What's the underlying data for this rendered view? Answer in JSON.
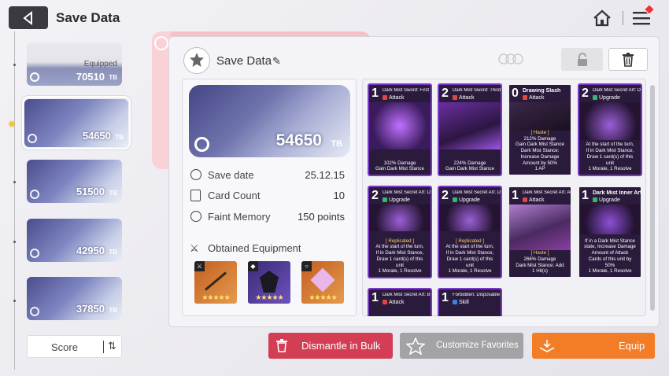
{
  "header": {
    "title": "Save Data"
  },
  "slots": [
    {
      "value": "70510",
      "unit": "TB",
      "label": "Equipped"
    },
    {
      "value": "54650",
      "unit": "TB",
      "selected": true
    },
    {
      "value": "51500",
      "unit": "TB"
    },
    {
      "value": "42950",
      "unit": "TB"
    },
    {
      "value": "37850",
      "unit": "TB"
    }
  ],
  "sort": {
    "label": "Score"
  },
  "panel": {
    "title": "Save Data",
    "big_value": "54650",
    "big_unit": "TB",
    "rows": [
      {
        "label": "Save date",
        "value": "25.12.15"
      },
      {
        "label": "Card Count",
        "value": "10"
      },
      {
        "label": "Faint Memory",
        "value": "150 points"
      }
    ],
    "equipment_title": "Obtained Equipment",
    "equipment": [
      {
        "stars": "★★★★★",
        "kind": "sword-icon"
      },
      {
        "stars": "★★★★★",
        "kind": "armor-icon"
      },
      {
        "stars": "★★★★★",
        "kind": "ring-icon"
      }
    ]
  },
  "cards": [
    {
      "cost": "1",
      "name": "Dark Mist Sword: First Form",
      "type": "Attack",
      "color": "#e0473e",
      "desc": [
        "102% Damage",
        "Gain Dark Mist Stance"
      ]
    },
    {
      "cost": "2",
      "name": "Dark Mist Sword: Third Form",
      "type": "Attack",
      "color": "#e0473e",
      "desc": [
        "224% Damage",
        "Gain Dark Mist Stance"
      ]
    },
    {
      "cost": "0",
      "name": "Drawing Slash",
      "type": "Attack",
      "color": "#e0473e",
      "desc": [
        "[ Haste ]",
        "212% Damage",
        "Gain Dark Mist Stance",
        "Dark Mist Stance:",
        "Increase Damage",
        "Amount by 50%",
        "1 AP"
      ]
    },
    {
      "cost": "2",
      "name": "Dark Mist Secret Art: Destruction",
      "type": "Upgrade",
      "color": "#37b86b",
      "desc": [
        "At the start of the turn,",
        "If in Dark Mist Stance,",
        "Draw 1 card(s) of this",
        "unit",
        "1 Morale, 1 Resolve"
      ]
    },
    {
      "cost": "2",
      "name": "Dark Mist Secret Art: Destruction",
      "type": "Upgrade",
      "color": "#37b86b",
      "desc": [
        "[ Replicated ]",
        "At the start of the turn,",
        "If in Dark Mist Stance,",
        "Draw 1 card(s) of this",
        "unit",
        "1 Morale, 1 Resolve"
      ]
    },
    {
      "cost": "2",
      "name": "Dark Mist Secret Art: Destruction",
      "type": "Upgrade",
      "color": "#37b86b",
      "desc": [
        "[ Replicated ]",
        "At the start of the turn,",
        "If in Dark Mist Stance,",
        "Draw 1 card(s) of this",
        "unit",
        "1 Morale, 1 Resolve"
      ]
    },
    {
      "cost": "1",
      "name": "Dark Mist Secret Art: Annihilation",
      "type": "Attack",
      "color": "#e0473e",
      "desc": [
        "[ Haste ]",
        "266% Damage",
        "Dark Mist Stance: Add",
        "1 Hit(s)"
      ]
    },
    {
      "cost": "1",
      "name": "Dark Mist Inner Art",
      "type": "Upgrade",
      "color": "#37b86b",
      "desc": [
        "If in a Dark Mist Stance",
        "state, Increase Damage",
        "Amount of Attack",
        "Cards of this unit by",
        "50%",
        "1 Morale, 1 Resolve"
      ]
    },
    {
      "cost": "1",
      "name": "Dark Mist Secret Art: Black Dance",
      "type": "Attack",
      "color": "#e0473e",
      "desc": []
    },
    {
      "cost": "1",
      "name": "Forbidden: Disposable Ego",
      "type": "Skill",
      "color": "#3a82e0",
      "desc": []
    }
  ],
  "buttons": {
    "dismantle": "Dismantle in Bulk",
    "customize": "Customize Favorites",
    "equip": "Equip"
  }
}
